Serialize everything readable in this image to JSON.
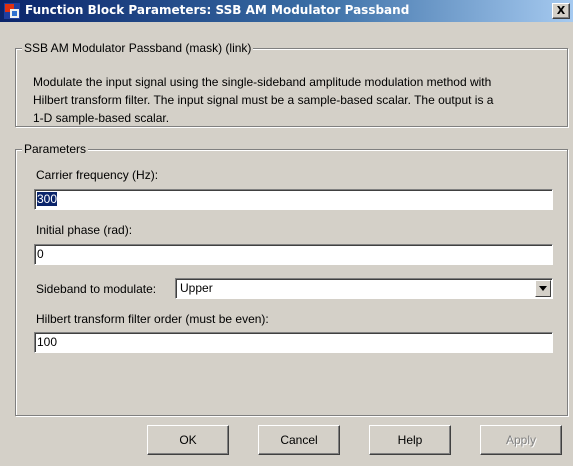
{
  "window": {
    "title": "Function Block Parameters: SSB AM Modulator Passband",
    "close_glyph": "X",
    "icon": "simulink-block-icon"
  },
  "mask": {
    "group_title": "SSB AM Modulator Passband (mask) (link)",
    "description_lines": [
      "Modulate the input signal using the single-sideband amplitude modulation method with",
      "Hilbert transform filter. The input signal must be a sample-based scalar. The output is a",
      "1-D sample-based scalar."
    ]
  },
  "parameters": {
    "group_title": "Parameters",
    "carrier_frequency": {
      "label": "Carrier frequency (Hz):",
      "value": "300"
    },
    "initial_phase": {
      "label": "Initial phase (rad):",
      "value": "0"
    },
    "sideband": {
      "label": "Sideband to modulate:",
      "value": "Upper"
    },
    "hilbert_order": {
      "label": "Hilbert transform filter order (must be even):",
      "value": "100"
    }
  },
  "buttons": {
    "ok": "OK",
    "cancel": "Cancel",
    "help": "Help",
    "apply": "Apply"
  },
  "colors": {
    "dialog_face": "#d4d0c8",
    "titlebar_start": "#0a246a",
    "titlebar_end": "#a6caf0",
    "selection": "#0a246a"
  }
}
